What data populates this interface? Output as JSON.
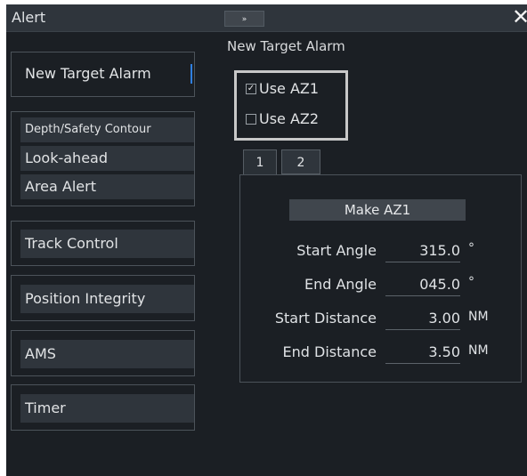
{
  "window": {
    "title": "Alert",
    "collapse_glyph": "»",
    "close_glyph": "✕"
  },
  "sidebar": {
    "items": [
      {
        "label": "New Target Alarm",
        "selected": true
      },
      {
        "label": "Depth/Safety Contour"
      },
      {
        "label": "Look-ahead"
      },
      {
        "label": "Area Alert"
      },
      {
        "label": "Track Control"
      },
      {
        "label": "Position Integrity"
      },
      {
        "label": "AMS"
      },
      {
        "label": "Timer"
      }
    ]
  },
  "content": {
    "title": "New Target Alarm",
    "use_az1": {
      "label": "Use AZ1",
      "checked": true
    },
    "use_az2": {
      "label": "Use AZ2",
      "checked": false
    },
    "tabs": [
      {
        "label": "1",
        "active": true
      },
      {
        "label": "2",
        "active": false
      }
    ],
    "make_button": "Make AZ1",
    "fields": [
      {
        "label": "Start Angle",
        "value": "315.0",
        "unit": "°"
      },
      {
        "label": "End Angle",
        "value": "045.0",
        "unit": "°"
      },
      {
        "label": "Start Distance",
        "value": "3.00",
        "unit": "NM"
      },
      {
        "label": "End Distance",
        "value": "3.50",
        "unit": "NM"
      }
    ]
  },
  "colors": {
    "background": "#1b1f24",
    "titlebar": "#2f353c",
    "button": "#2f353c",
    "selection_marker": "#2f7fe0",
    "highlight_box": "#c8c8c8"
  }
}
